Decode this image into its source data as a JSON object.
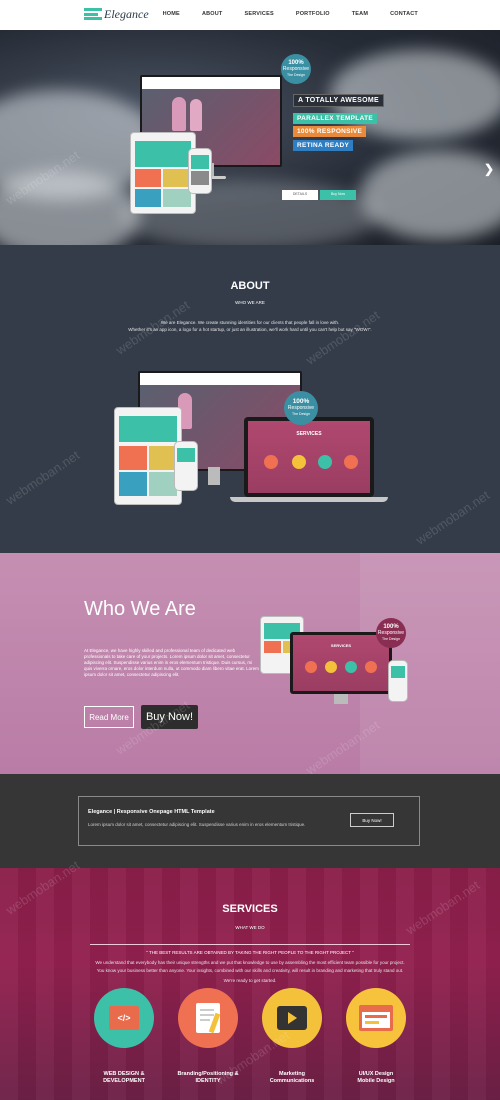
{
  "nav": {
    "logo": "Elegance",
    "menu": [
      "HOME",
      "ABOUT",
      "SERVICES",
      "PORTFOLIO",
      "TEAM",
      "CONTACT"
    ]
  },
  "hero": {
    "badge": [
      "100%",
      "Responsive",
      "The Design"
    ],
    "tags": [
      "A TOTALLY AWESOME",
      "PARALLEX TEMPLATE",
      "100% RESPONSIVE",
      "RETINA READY"
    ],
    "buttons": [
      "DETAILS",
      "Buy Now"
    ],
    "next_icon": "chevron-right-icon",
    "dots": 5,
    "tag_colors": [
      "#2b2f38",
      "#3cc0a8",
      "#e98a3b",
      "#2f7ec2"
    ]
  },
  "about": {
    "title": "ABOUT",
    "subtitle": "WHO WE ARE",
    "text1": "We are Elegance. We create stunning identities for our clients that people fall in love with.",
    "text2": "Whether it's an app icon, a logo for a hot startup, or just an illustration, we'll work hard until you can't help but say \"WOW!\".",
    "badge": [
      "100%",
      "Responsive",
      "The Design"
    ],
    "screen_title": "SERVICES"
  },
  "who": {
    "title": "Who We Are",
    "text": "At Elegance, we have highly skilled and professional team of dedicated web professionals to take care of your projects. Lorem ipsum dolor sit amet, consectetur adipiscing elit. Suspendisse varius enim in eros elementum tristique. Duis cursus, mi quis viverra ornare, eros dolor interdum nulla, ut commodo diam libero vitae erat. Lorem ipsum dolor sit amet, consectetur adipiscing elit.",
    "read_more": "Read More",
    "buy_now": "Buy Now!",
    "badge": [
      "100%",
      "Responsive",
      "The Design"
    ],
    "screen_title": "SERVICES"
  },
  "callout": {
    "title": "Elegance | Responsive Onepage HTML Template",
    "text": "Lorem ipsum dolor sit amet, consectetur adipiscing elit. Suspendisse varius enim in eros elementum tristique.",
    "button": "Buy Now!"
  },
  "services": {
    "title": "SERVICES",
    "subtitle": "WHAT WE DO",
    "quote": "\" THE BEST RESULTS ARE OBTAINED BY TAKING THE RIGHT PEOPLE TO THE RIGHT PROJECT \"",
    "lines": [
      "We understand that everybody has their unique strengths and we put that knowledge to use by assembling the most efficient team possible for your project.",
      "You know your business better than anyone. Your insights, combined with our skills and creativity, will result in branding and marketing that truly stand out.",
      "We're ready to get started."
    ],
    "items": [
      {
        "label1": "WEB DESIGN &",
        "label2": "DEVELOPMENT",
        "icon": "code-icon",
        "color": "#3cc0a8"
      },
      {
        "label1": "Branding/Positioning &",
        "label2": "IDENTITY",
        "icon": "document-pencil-icon",
        "color": "#f07152"
      },
      {
        "label1": "Marketing",
        "label2": "Communications",
        "icon": "play-icon",
        "color": "#f3c13a"
      },
      {
        "label1": "UI/UX Design",
        "label2": "Mobile Design",
        "icon": "browser-window-icon",
        "color": "#f7c33c"
      }
    ]
  },
  "watermark": "webmoban.net"
}
